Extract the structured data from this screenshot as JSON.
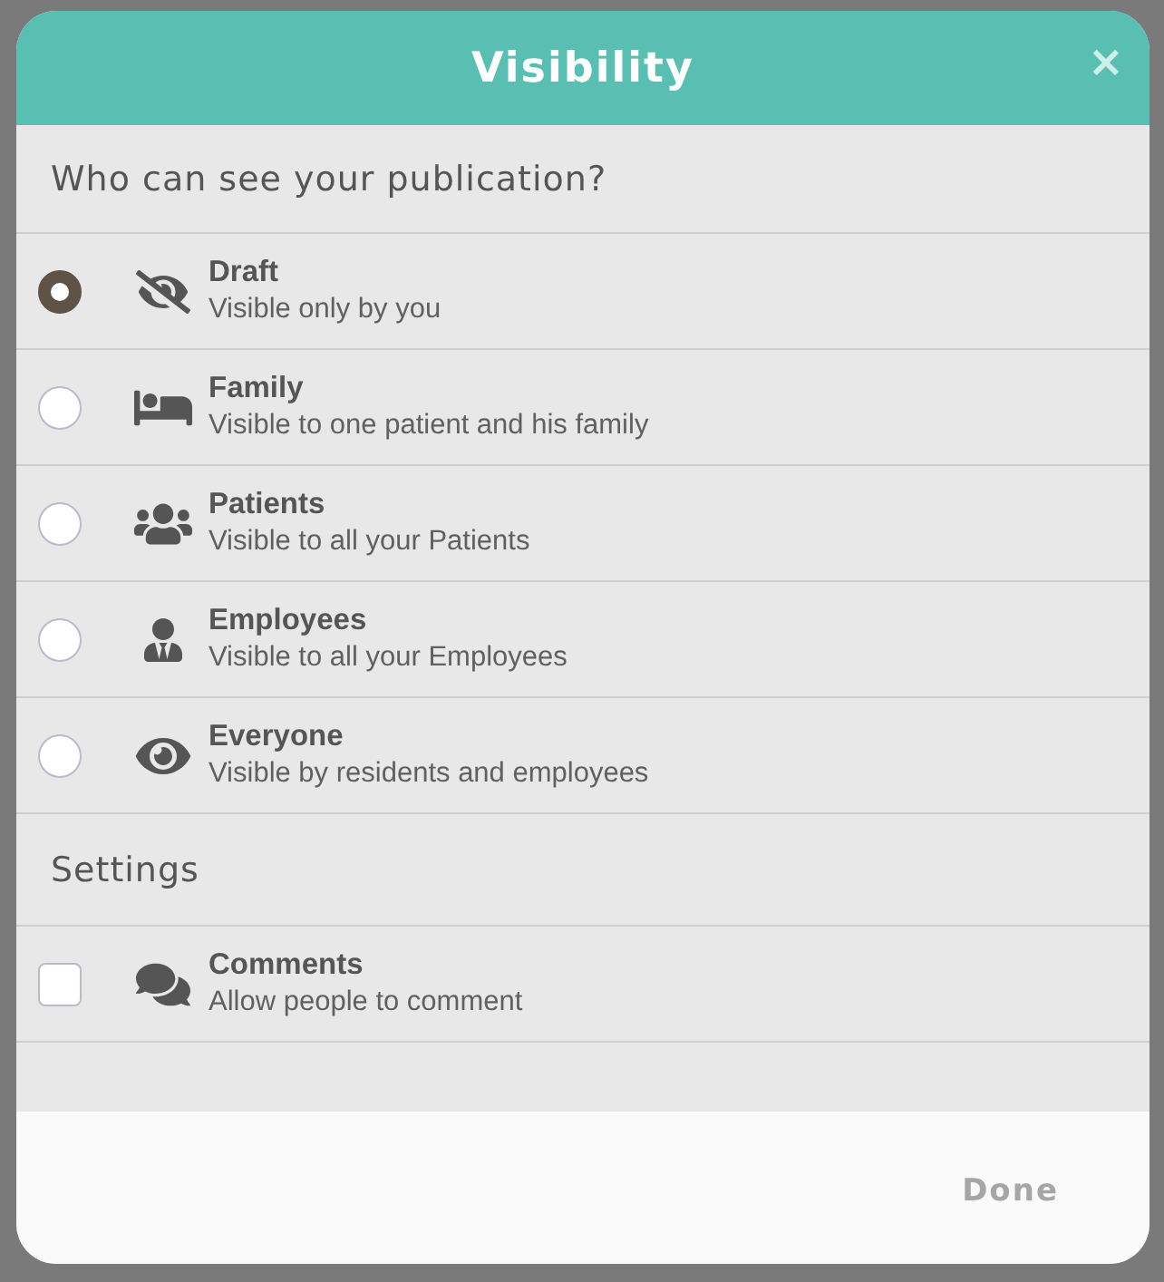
{
  "dialog": {
    "title": "Visibility",
    "close": "×"
  },
  "audience": {
    "heading": "Who can see your publication?",
    "options": [
      {
        "label": "Draft",
        "description": "Visible only by you",
        "selected": true
      },
      {
        "label": "Family",
        "description": "Visible to one patient and his family",
        "selected": false
      },
      {
        "label": "Patients",
        "description": "Visible to all your Patients",
        "selected": false
      },
      {
        "label": "Employees",
        "description": "Visible to all your Employees",
        "selected": false
      },
      {
        "label": "Everyone",
        "description": "Visible by residents and employees",
        "selected": false
      }
    ]
  },
  "settings": {
    "heading": "Settings",
    "options": [
      {
        "label": "Comments",
        "description": "Allow people to comment",
        "checked": false
      }
    ]
  },
  "footer": {
    "done": {
      "label": "Done",
      "disabled": true
    }
  }
}
